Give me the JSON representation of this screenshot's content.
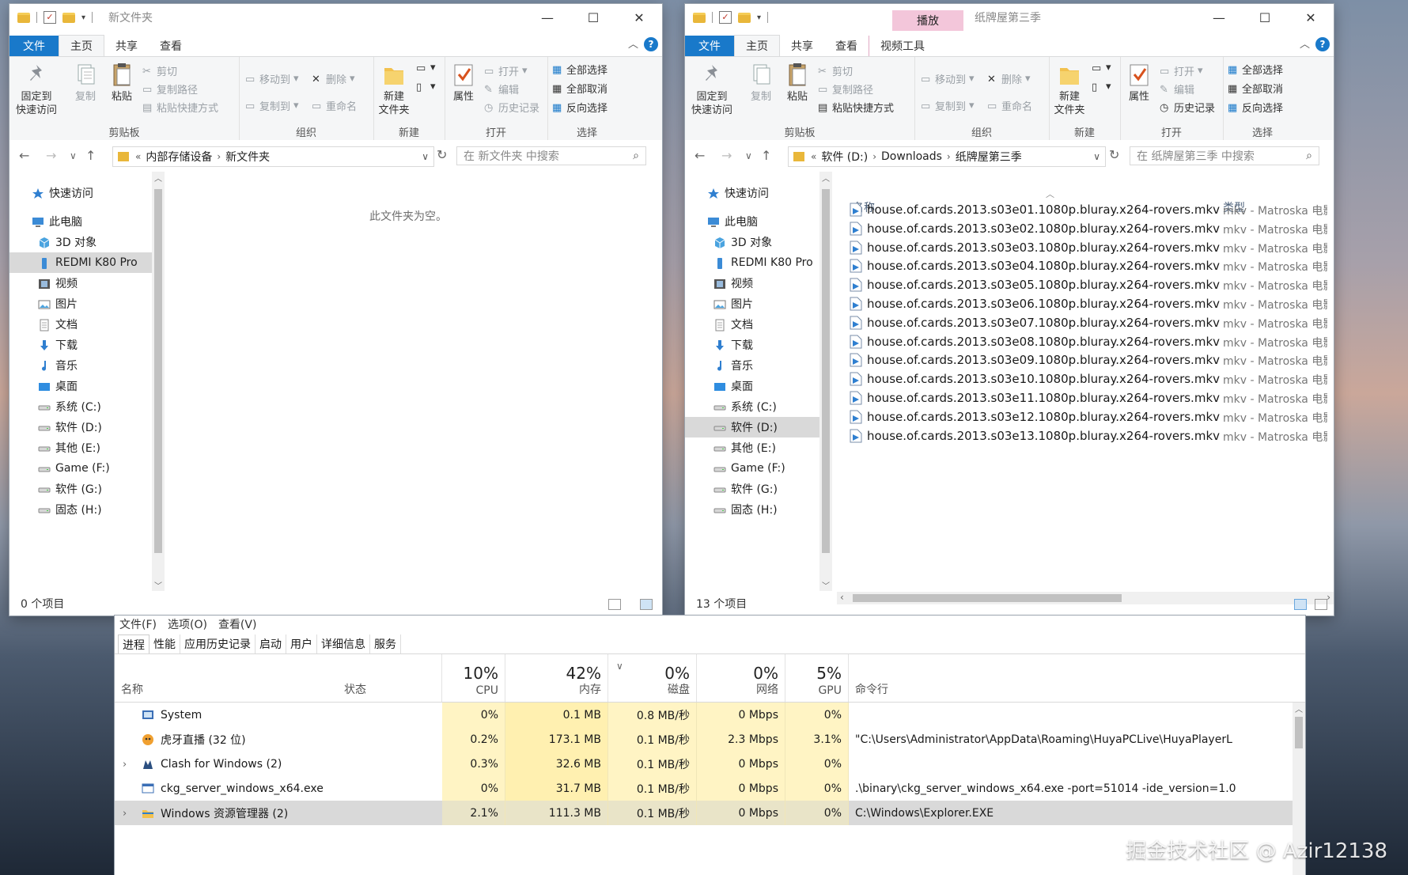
{
  "left_window": {
    "title": "新文件夹",
    "tabs": [
      "文件",
      "主页",
      "共享",
      "查看"
    ],
    "ribbon": {
      "clipboard": {
        "pin": "固定到\n快速访问",
        "copy": "复制",
        "paste": "粘贴",
        "cut": "剪切",
        "copy_path": "复制路径",
        "paste_shortcut": "粘贴快捷方式",
        "label": "剪贴板"
      },
      "organize": {
        "move_to": "移动到",
        "copy_to": "复制到",
        "delete": "删除",
        "rename": "重命名",
        "label": "组织"
      },
      "new": {
        "new_folder": "新建\n文件夹",
        "label": "新建"
      },
      "open": {
        "properties": "属性",
        "open": "打开",
        "edit": "编辑",
        "history": "历史记录",
        "label": "打开"
      },
      "select": {
        "select_all": "全部选择",
        "select_none": "全部取消",
        "invert": "反向选择",
        "label": "选择"
      }
    },
    "path": [
      "内部存储设备",
      "新文件夹"
    ],
    "search_placeholder": "在 新文件夹 中搜索",
    "empty_text": "此文件夹为空。",
    "status": "0 个项目"
  },
  "right_window": {
    "title": "纸牌屋第三季",
    "context_tab": "播放",
    "context_tab_sub": "视频工具",
    "tabs": [
      "文件",
      "主页",
      "共享",
      "查看"
    ],
    "path": [
      "软件 (D:)",
      "Downloads",
      "纸牌屋第三季"
    ],
    "search_placeholder": "在 纸牌屋第三季 中搜索",
    "col_name": "名称",
    "col_type": "类型",
    "status": "13 个项目",
    "files": [
      "house.of.cards.2013.s03e01.1080p.bluray.x264-rovers.mkv",
      "house.of.cards.2013.s03e02.1080p.bluray.x264-rovers.mkv",
      "house.of.cards.2013.s03e03.1080p.bluray.x264-rovers.mkv",
      "house.of.cards.2013.s03e04.1080p.bluray.x264-rovers.mkv",
      "house.of.cards.2013.s03e05.1080p.bluray.x264-rovers.mkv",
      "house.of.cards.2013.s03e06.1080p.bluray.x264-rovers.mkv",
      "house.of.cards.2013.s03e07.1080p.bluray.x264-rovers.mkv",
      "house.of.cards.2013.s03e08.1080p.bluray.x264-rovers.mkv",
      "house.of.cards.2013.s03e09.1080p.bluray.x264-rovers.mkv",
      "house.of.cards.2013.s03e10.1080p.bluray.x264-rovers.mkv",
      "house.of.cards.2013.s03e11.1080p.bluray.x264-rovers.mkv",
      "house.of.cards.2013.s03e12.1080p.bluray.x264-rovers.mkv",
      "house.of.cards.2013.s03e13.1080p.bluray.x264-rovers.mkv"
    ],
    "file_type": "mkv - Matroska 电影"
  },
  "nav_items": [
    {
      "label": "快速访问",
      "icon": "star-icon"
    },
    {
      "label": "此电脑",
      "icon": "pc-icon"
    },
    {
      "label": "3D 对象",
      "icon": "cube-icon"
    },
    {
      "label": "REDMI K80 Pro",
      "icon": "phone-icon"
    },
    {
      "label": "视频",
      "icon": "video-icon"
    },
    {
      "label": "图片",
      "icon": "picture-icon"
    },
    {
      "label": "文档",
      "icon": "document-icon"
    },
    {
      "label": "下载",
      "icon": "download-icon"
    },
    {
      "label": "音乐",
      "icon": "music-icon"
    },
    {
      "label": "桌面",
      "icon": "desktop-icon"
    },
    {
      "label": "系统 (C:)",
      "icon": "drive-icon"
    },
    {
      "label": "软件 (D:)",
      "icon": "drive-icon"
    },
    {
      "label": "其他 (E:)",
      "icon": "drive-icon"
    },
    {
      "label": "Game (F:)",
      "icon": "drive-icon"
    },
    {
      "label": "软件 (G:)",
      "icon": "drive-icon"
    },
    {
      "label": "固态 (H:)",
      "icon": "drive-icon"
    }
  ],
  "task_manager": {
    "menu": [
      "文件(F)",
      "选项(O)",
      "查看(V)"
    ],
    "tabs": [
      "进程",
      "性能",
      "应用历史记录",
      "启动",
      "用户",
      "详细信息",
      "服务"
    ],
    "headers": {
      "name": "名称",
      "status": "状态",
      "cpu_pct": "10%",
      "cpu": "CPU",
      "mem_pct": "42%",
      "mem": "内存",
      "disk_pct": "0%",
      "disk": "磁盘",
      "net_pct": "0%",
      "net": "网络",
      "gpu_pct": "5%",
      "gpu": "GPU",
      "cmd": "命令行"
    },
    "rows": [
      {
        "name": "System",
        "cpu": "0%",
        "mem": "0.1 MB",
        "disk": "0.8 MB/秒",
        "net": "0 Mbps",
        "gpu": "0%",
        "cmd": ""
      },
      {
        "name": "虎牙直播 (32 位)",
        "cpu": "0.2%",
        "mem": "173.1 MB",
        "disk": "0.1 MB/秒",
        "net": "2.3 Mbps",
        "gpu": "3.1%",
        "cmd": "\"C:\\Users\\Administrator\\AppData\\Roaming\\HuyaPCLive\\HuyaPlayerL"
      },
      {
        "name": "Clash for Windows (2)",
        "cpu": "0.3%",
        "mem": "32.6 MB",
        "disk": "0.1 MB/秒",
        "net": "0 Mbps",
        "gpu": "0%",
        "cmd": ""
      },
      {
        "name": "ckg_server_windows_x64.exe",
        "cpu": "0%",
        "mem": "31.7 MB",
        "disk": "0.1 MB/秒",
        "net": "0 Mbps",
        "gpu": "0%",
        "cmd": ".\\binary\\ckg_server_windows_x64.exe  -port=51014 -ide_version=1.0"
      },
      {
        "name": "Windows 资源管理器 (2)",
        "cpu": "2.1%",
        "mem": "111.3 MB",
        "disk": "0.1 MB/秒",
        "net": "0 Mbps",
        "gpu": "0%",
        "cmd": "C:\\Windows\\Explorer.EXE"
      }
    ]
  },
  "watermark": "掘金技术社区 @ Azir12138",
  "colors": {
    "accent": "#1979ca",
    "file_tab": "#1979ca",
    "context_tab": "#f3c6da",
    "cpu_heat": "#fff4c4"
  }
}
